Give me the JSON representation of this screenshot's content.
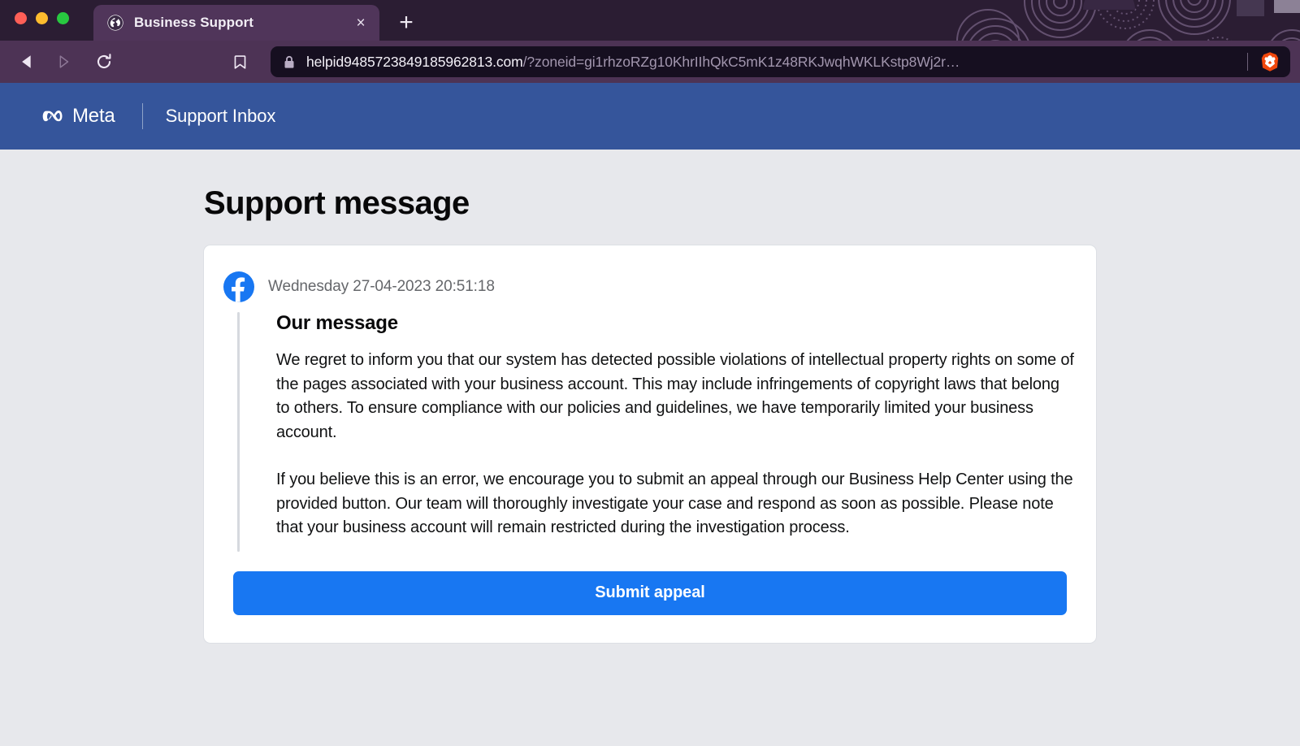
{
  "browser": {
    "window_controls": [
      "close",
      "minimize",
      "maximize"
    ],
    "tab": {
      "title": "Business Support",
      "favicon": "globe-icon",
      "close_label": "×"
    },
    "new_tab_label": "+",
    "nav": {
      "back": "back-arrow-icon",
      "forward": "forward-arrow-icon",
      "reload": "reload-icon",
      "bookmark": "bookmark-icon"
    },
    "omnibox": {
      "lock": "lock-icon",
      "url_domain": "helpid9485723849185962813.com",
      "url_query": "/?zoneid=gi1rhzoRZg10KhrIIhQkC5mK1z48RKJwqhWKLKstp8Wj2r…",
      "extension_icon": "brave-lion-icon"
    }
  },
  "site_header": {
    "brand": "Meta",
    "brand_mark": "meta-infinity-icon",
    "section": "Support Inbox"
  },
  "main": {
    "page_title": "Support message",
    "message": {
      "avatar": "facebook-icon",
      "timestamp": "Wednesday 27-04-2023 20:51:18",
      "heading": "Our message",
      "paragraphs": [
        "We regret to inform you that our system has detected possible violations of intellectual property rights on some of the pages associated with your business account. This may include infringements of copyright laws that belong to others. To ensure compliance with our policies and guidelines, we have temporarily limited your business account.",
        "If you believe this is an error, we encourage you to submit an appeal through our Business Help Center using the provided button. Our team will thoroughly investigate your case and respond as soon as possible. Please note that your business account will remain restricted during the investigation process."
      ],
      "submit_label": "Submit appeal"
    }
  },
  "colors": {
    "meta_blue": "#35559b",
    "button_blue": "#1877f2",
    "page_background": "#e7e8ec",
    "chrome_tabstrip": "#2b1d33",
    "chrome_toolbar": "#4d3355",
    "omnibox_background": "#160f20",
    "brave_orange": "#f0470c"
  }
}
